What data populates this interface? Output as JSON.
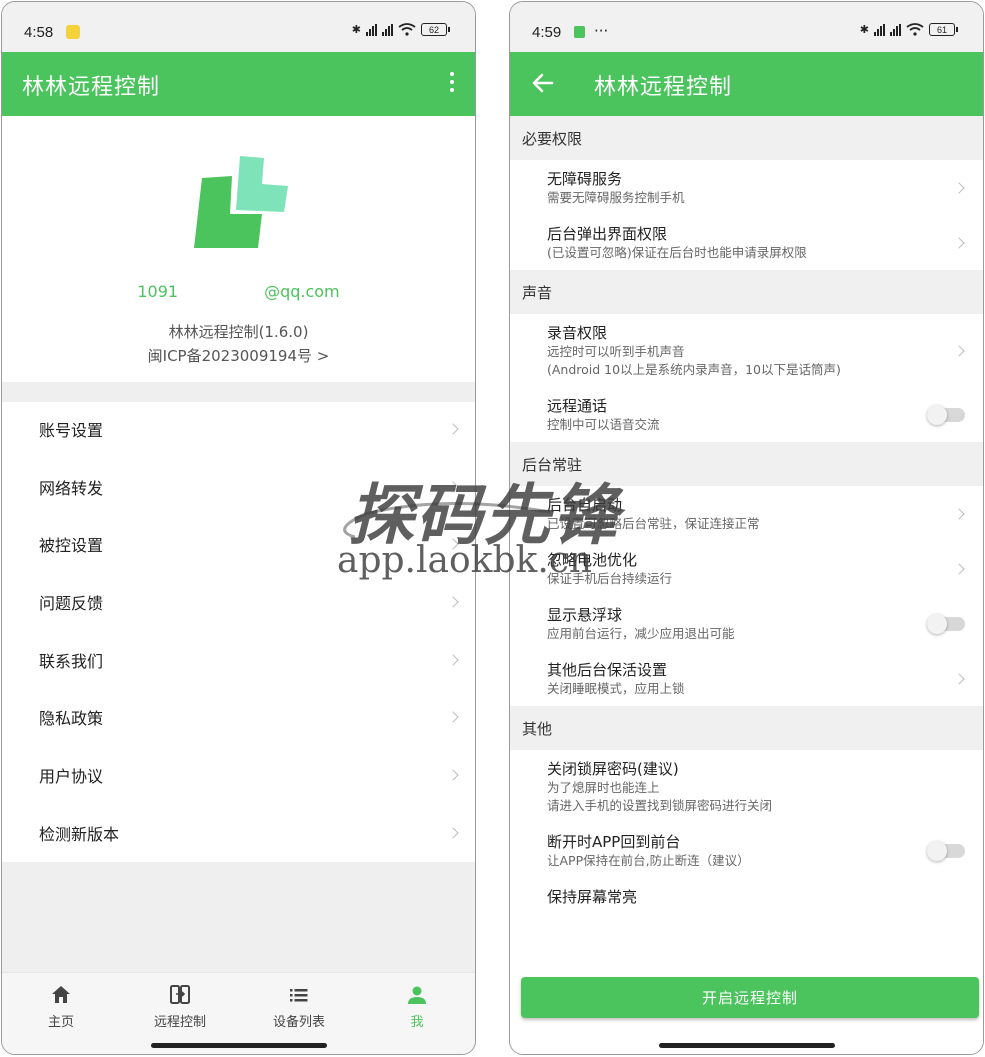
{
  "left_screen": {
    "status_bar": {
      "time": "4:58",
      "battery": "62"
    },
    "app_bar": {
      "title": "林林远程控制"
    },
    "profile": {
      "email_prefix": "1091",
      "email_suffix": "@qq.com",
      "version": "林林远程控制(1.6.0)",
      "icp": "闽ICP备2023009194号 >"
    },
    "menu": [
      {
        "label": "账号设置"
      },
      {
        "label": "网络转发"
      },
      {
        "label": "被控设置"
      },
      {
        "label": "问题反馈"
      },
      {
        "label": "联系我们"
      },
      {
        "label": "隐私政策"
      },
      {
        "label": "用户协议"
      },
      {
        "label": "检测新版本"
      }
    ],
    "bottom_nav": [
      {
        "label": "主页",
        "icon": "home-icon",
        "active": false
      },
      {
        "label": "远程控制",
        "icon": "remote-control-icon",
        "active": false
      },
      {
        "label": "设备列表",
        "icon": "list-icon",
        "active": false
      },
      {
        "label": "我",
        "icon": "person-icon",
        "active": true
      }
    ]
  },
  "right_screen": {
    "status_bar": {
      "time": "4:59",
      "extra": "···",
      "battery": "61"
    },
    "app_bar": {
      "title": "林林远程控制"
    },
    "sections": [
      {
        "header": "必要权限",
        "rows": [
          {
            "title": "无障碍服务",
            "subtitles": [
              "需要无障碍服务控制手机"
            ],
            "control": "chevron"
          },
          {
            "title": "后台弹出界面权限",
            "subtitles": [
              "(已设置可忽略)保证在后台时也能申请录屏权限"
            ],
            "control": "chevron"
          }
        ]
      },
      {
        "header": "声音",
        "rows": [
          {
            "title": "录音权限",
            "subtitles": [
              "远控时可以听到手机声音",
              "(Android 10以上是系统内录声音，10以下是话筒声)"
            ],
            "control": "chevron"
          },
          {
            "title": "远程通话",
            "subtitles": [
              "控制中可以语音交流"
            ],
            "control": "toggle",
            "value": false
          }
        ]
      },
      {
        "header": "后台常驻",
        "rows": [
          {
            "title": "后台自启动",
            "subtitles": [
              "已设置可忽略后台常驻，保证连接正常"
            ],
            "control": "chevron"
          },
          {
            "title": "忽略电池优化",
            "subtitles": [
              "保证手机后台持续运行"
            ],
            "control": "chevron"
          },
          {
            "title": "显示悬浮球",
            "subtitles": [
              "应用前台运行，减少应用退出可能"
            ],
            "control": "toggle",
            "value": false
          },
          {
            "title": "其他后台保活设置",
            "subtitles": [
              "关闭睡眠模式，应用上锁"
            ],
            "control": "chevron"
          }
        ]
      },
      {
        "header": "其他",
        "rows": [
          {
            "title": "关闭锁屏密码(建议)",
            "subtitles": [
              "为了熄屏时也能连上",
              "请进入手机的设置找到锁屏密码进行关闭"
            ],
            "control": "none"
          },
          {
            "title": "断开时APP回到前台",
            "subtitles": [
              "让APP保持在前台,防止断连（建议）"
            ],
            "control": "toggle",
            "value": false
          },
          {
            "title": "保持屏幕常亮",
            "subtitles": [],
            "control": "none"
          }
        ]
      }
    ],
    "cta": {
      "label": "开启远程控制"
    }
  },
  "watermark": {
    "title": "探码先锋",
    "url": "app.laokbk.cn"
  },
  "colors": {
    "accent": "#4cc45e",
    "logo_dark": "#4cc45e",
    "logo_light": "#7fe3b9"
  }
}
